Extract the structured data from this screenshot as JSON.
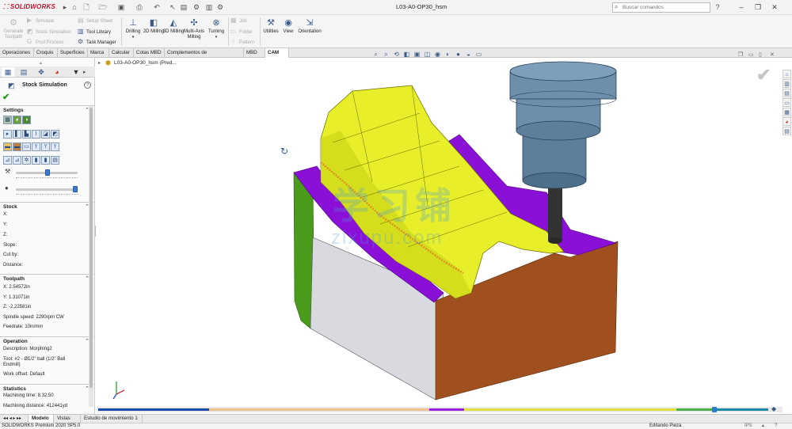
{
  "app": {
    "logo_text": "SOLIDWORKS",
    "document_title": "L03-A0-OP30_hsm",
    "search_placeholder": "Buscar comandos"
  },
  "ribbon": {
    "cam_left": [
      {
        "label": "Generate Toolpath",
        "icon": "toolpath-icon",
        "enabled": false
      },
      {
        "label": "Simulate",
        "icon": "simulate-icon",
        "enabled": false
      },
      {
        "label": "Stock Simulation",
        "icon": "stock-sim-icon",
        "enabled": false
      },
      {
        "label": "Post Process",
        "icon": "post-process-icon",
        "enabled": false
      },
      {
        "label": "Setup Sheet",
        "icon": "setup-sheet-icon",
        "enabled": false
      },
      {
        "label": "Tool Library",
        "icon": "tool-library-icon",
        "enabled": true
      },
      {
        "label": "Task Manager",
        "icon": "task-manager-icon",
        "enabled": true
      }
    ],
    "milling": [
      {
        "label": "Drilling",
        "icon": "drill-icon"
      },
      {
        "label": "2D Milling",
        "icon": "mill-2d-icon"
      },
      {
        "label": "3D Milling",
        "icon": "mill-3d-icon"
      },
      {
        "label": "Multi-Axis Milling",
        "icon": "multiaxis-icon"
      },
      {
        "label": "Turning",
        "icon": "turning-icon"
      }
    ],
    "manage": [
      {
        "label": "Job",
        "enabled": false
      },
      {
        "label": "Folder",
        "enabled": false
      },
      {
        "label": "Pattern",
        "enabled": false
      }
    ],
    "utilities": [
      {
        "label": "Utilities",
        "icon": "utilities-icon"
      },
      {
        "label": "View",
        "icon": "view-icon"
      },
      {
        "label": "Orientation",
        "icon": "orientation-icon"
      }
    ]
  },
  "tabs": [
    "Operaciones",
    "Croquis",
    "Superficies",
    "Marca",
    "Calcular",
    "Cotas MBD",
    "Complementos de SOLIDWORKS",
    "MBD",
    "CAM"
  ],
  "active_tab": "CAM",
  "panel": {
    "title": "Stock Simulation",
    "help": "?",
    "settings": {
      "title": "Settings"
    },
    "stock": {
      "title": "Stock",
      "fields": [
        "X:",
        "Y:",
        "Z:",
        "Slope:",
        "Cut by:",
        "Distance:"
      ]
    },
    "toolpath": {
      "title": "Toolpath",
      "x": "X: 2.54572in",
      "y": "Y: 1.31071in",
      "z": "Z: -2.22581in",
      "spindle": "Spindle speed: 2290rpm CW",
      "feedrate": "Feedrate: 10in/min"
    },
    "operation": {
      "title": "Operation",
      "description": "Description: Morphing2",
      "tool_line1": "Tool: #2 - Ø1/2\" ball (1/2\" Ball",
      "tool_line2": "Endmill)",
      "offset": "Work offset: Default"
    },
    "statistics": {
      "title": "Statistics",
      "time": "Machining time: 8:32:50",
      "distance": "Machining distance: 412441yd"
    }
  },
  "tree_item": "L03-A0-OP30_hsm  (Pred...",
  "watermark": {
    "cn": "学习铺",
    "en": "zixupu.com"
  },
  "bottom_tabs": [
    "Modelo",
    "Vistas 3D",
    "Estudio de movimiento 1"
  ],
  "active_bottom_tab": "Modelo",
  "status": {
    "left": "SOLIDWORKS Premium 2020 SP5.0",
    "mid": "Editando Pieza",
    "units": "IPS"
  },
  "colors": {
    "accent": "#3a5a8a",
    "part_yellow": "#e7ef2a",
    "part_purple": "#8a10d8",
    "part_green": "#4a9a1c",
    "part_brown": "#a0501e",
    "part_gray": "#d9d9e0",
    "tool_blue": "#5e7f9c"
  }
}
